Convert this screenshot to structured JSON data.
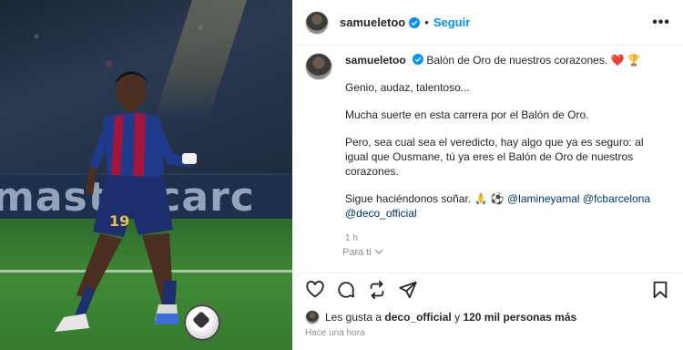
{
  "photo": {
    "board_text": "mastercarc",
    "shirt_number": "19"
  },
  "header": {
    "username": "samueletoo",
    "separator": "•",
    "follow_label": "Seguir",
    "more_label": "•••"
  },
  "caption": {
    "username": "samueletoo",
    "headline": "Balón de Oro de nuestros corazones.",
    "emojis": "❤️ 🏆",
    "p1": "Genio, audaz, talentoso...",
    "p2": "Mucha suerte en esta carrera por el Balón de Oro.",
    "p3": "Pero, sea cual sea el veredicto, hay algo que ya es seguro: al igual que Ousmane, tú ya eres el Balón de Oro de nuestros corazones.",
    "p4_text": "Sigue haciéndonos soñar. 🙏 ⚽",
    "mentions": [
      "@lamineyamal",
      "@fcbarcelona",
      "@deco_official"
    ],
    "time": "1 h",
    "translate": "Para ti"
  },
  "likes": {
    "prefix": "Les gusta a",
    "user": "deco_official",
    "connector": "y",
    "others": "120 mil personas más"
  },
  "posted": "Hace una hora",
  "colors": {
    "link": "#0095f6",
    "mention": "#00376b",
    "muted": "#8e8e8e",
    "verified": "#0095f6",
    "shirt_blue": "#1f3a8a",
    "shirt_red": "#a3153a"
  }
}
